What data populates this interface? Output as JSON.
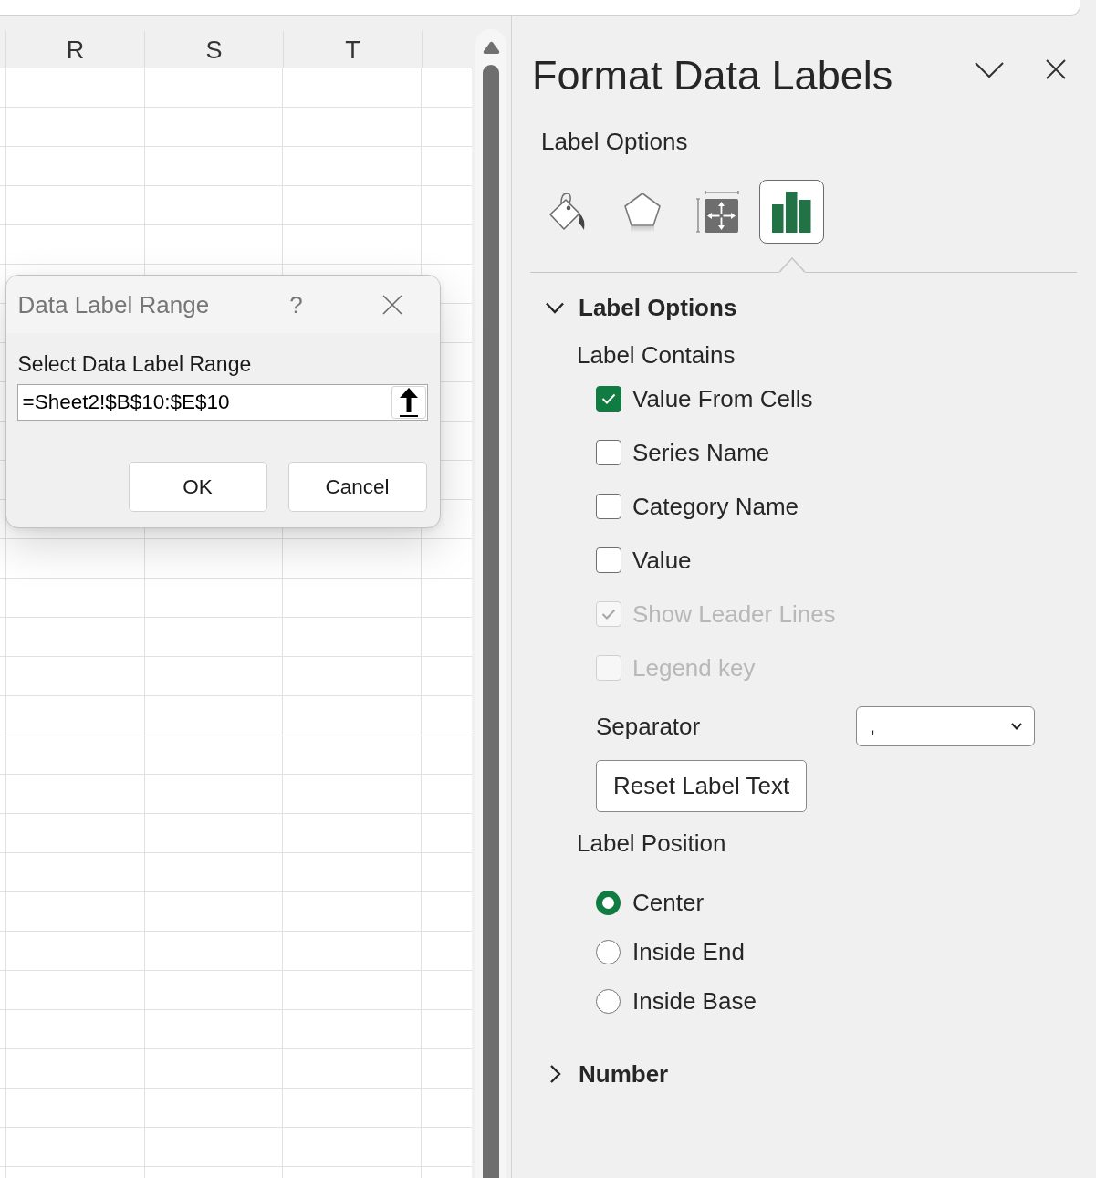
{
  "sheet": {
    "columns": [
      {
        "heading": "R"
      },
      {
        "heading": "S"
      },
      {
        "heading": "T"
      }
    ]
  },
  "dialog": {
    "title": "Data Label Range",
    "help": "?",
    "prompt": "Select Data Label Range",
    "range_field": {
      "value": "=Sheet2!$B$10:$E$10"
    },
    "buttons": [
      {
        "label": "OK"
      },
      {
        "label": "Cancel"
      }
    ]
  },
  "panel": {
    "title": "Format Data Labels",
    "category": "Label Options",
    "icon_tabs": [
      {
        "kind": "fill",
        "selected": false
      },
      {
        "kind": "shape",
        "selected": false
      },
      {
        "kind": "size",
        "selected": false
      },
      {
        "kind": "chart",
        "selected": true
      }
    ],
    "sections": [
      {
        "title": "Label Options",
        "expanded": true,
        "contains_heading": "Label Contains",
        "checkboxes": [
          {
            "label": "Value From Cells",
            "checked": true,
            "disabled": false
          },
          {
            "label": "Series Name",
            "checked": false,
            "disabled": false
          },
          {
            "label": "Category Name",
            "checked": false,
            "disabled": false
          },
          {
            "label": "Value",
            "checked": false,
            "disabled": false
          },
          {
            "label": "Show Leader Lines",
            "checked": true,
            "disabled": true
          },
          {
            "label": "Legend key",
            "checked": false,
            "disabled": true
          }
        ],
        "separator": {
          "label": "Separator",
          "value": ","
        },
        "reset_button": {
          "label": "Reset Label Text"
        },
        "position_heading": "Label Position",
        "positions": [
          {
            "label": "Center",
            "selected": true
          },
          {
            "label": "Inside End",
            "selected": false
          },
          {
            "label": "Inside Base",
            "selected": false
          }
        ]
      },
      {
        "title": "Number",
        "expanded": false
      }
    ]
  }
}
